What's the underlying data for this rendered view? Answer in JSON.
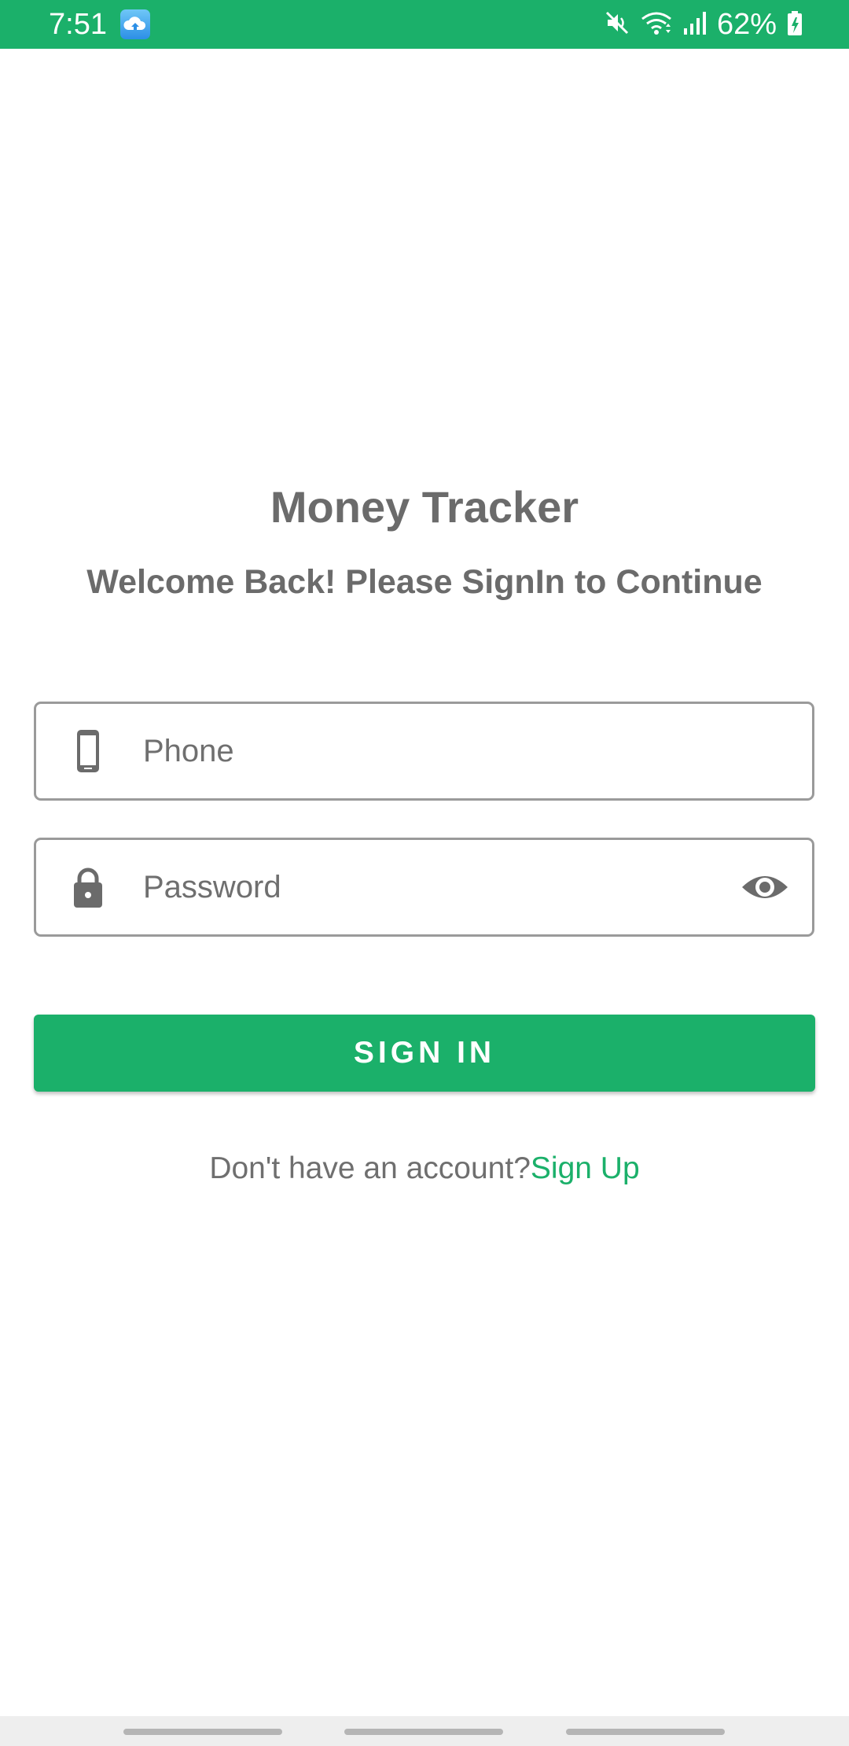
{
  "status_bar": {
    "time": "7:51",
    "battery_percent": "62%",
    "app_icon": "cloud-upload-icon",
    "icons": [
      "mute-icon",
      "wifi-icon",
      "signal-icon",
      "battery-charging-icon"
    ],
    "background_color": "#1bb06a"
  },
  "header": {
    "title": "Money Tracker",
    "subtitle": "Welcome Back! Please SignIn to Continue"
  },
  "form": {
    "phone": {
      "value": "",
      "placeholder": "Phone",
      "leading_icon": "phone-icon"
    },
    "password": {
      "value": "",
      "placeholder": "Password",
      "leading_icon": "lock-icon",
      "trailing_icon": "eye-icon"
    },
    "submit_label": "SIGN IN"
  },
  "footer": {
    "prompt": "Don't have an account?",
    "link_label": "Sign Up"
  },
  "colors": {
    "accent": "#1bb06a",
    "text_gray": "#6b6b6b",
    "border_gray": "#9a9a9a"
  }
}
